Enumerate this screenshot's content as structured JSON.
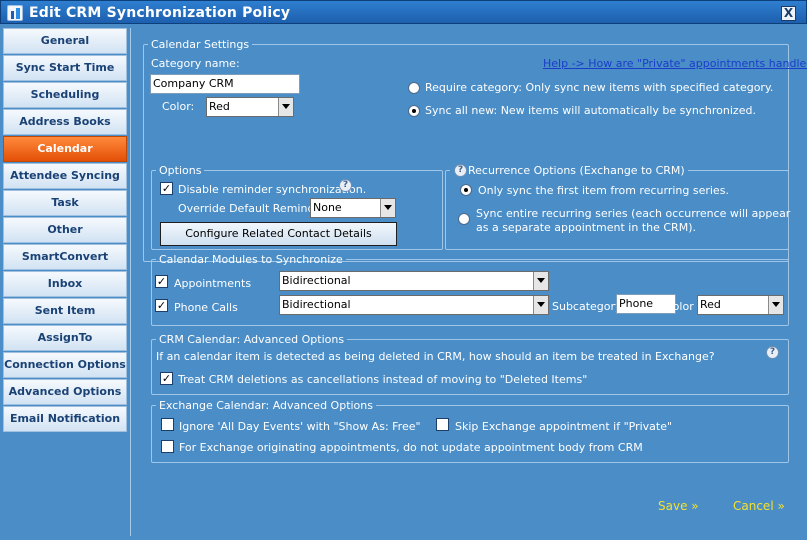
{
  "window": {
    "title": "Edit CRM Synchronization Policy",
    "close_label": "X"
  },
  "sidebar": {
    "items": [
      {
        "label": "General"
      },
      {
        "label": "Sync Start Time"
      },
      {
        "label": "Scheduling"
      },
      {
        "label": "Address Books"
      },
      {
        "label": "Calendar"
      },
      {
        "label": "Attendee Syncing"
      },
      {
        "label": "Task"
      },
      {
        "label": "Other"
      },
      {
        "label": "SmartConvert"
      },
      {
        "label": "Inbox"
      },
      {
        "label": "Sent Item"
      },
      {
        "label": "AssignTo"
      },
      {
        "label": "Connection Options"
      },
      {
        "label": "Advanced Options"
      },
      {
        "label": "Email Notification"
      }
    ],
    "active": "Calendar"
  },
  "calendar_settings": {
    "legend": "Calendar Settings",
    "category_label": "Category name:",
    "category_value": "Company CRM",
    "color_label": "Color:",
    "color_value": "Red",
    "help_link": "Help -> How are \"Private\" appointments handled?",
    "radio_require": "Require category: Only sync new items with specified category.",
    "radio_sync_all": "Sync all new: New items will automatically be synchronized."
  },
  "options": {
    "legend": "Options",
    "disable_reminder": "Disable reminder synchronization.",
    "override_label": "Override Default Reminder",
    "override_value": "None",
    "configure_button": "Configure Related Contact Details"
  },
  "recurrence": {
    "legend": "Recurrence Options (Exchange to CRM)",
    "first_only": "Only sync the first item from recurring series.",
    "entire_line1": "Sync entire recurring series (each occurrence will appear",
    "entire_line2": "as a separate appointment in the CRM)."
  },
  "modules": {
    "legend": "Calendar Modules to Synchronize",
    "appointments_label": "Appointments",
    "appointments_value": "Bidirectional",
    "phone_label": "Phone Calls",
    "phone_value": "Bidirectional",
    "subcategory_label": "Subcategory:",
    "subcategory_value": "Phone",
    "color_label": "Color",
    "color_value": "Red"
  },
  "crm_advanced": {
    "legend": "CRM Calendar: Advanced Options",
    "description": "If an calendar item is detected as being deleted in CRM, how should an item be treated in Exchange?",
    "treat_deletions": "Treat CRM deletions as cancellations instead of moving to \"Deleted Items\""
  },
  "exchange_advanced": {
    "legend": "Exchange Calendar: Advanced Options",
    "ignore_all_day": "Ignore 'All Day Events' with \"Show As: Free\"",
    "skip_private": "Skip Exchange appointment if \"Private\"",
    "no_update_body": "For Exchange originating appointments, do not update appointment body from CRM"
  },
  "footer": {
    "save": "Save »",
    "cancel": "Cancel »"
  },
  "glyphs": {
    "check": "✓",
    "help": "?"
  }
}
